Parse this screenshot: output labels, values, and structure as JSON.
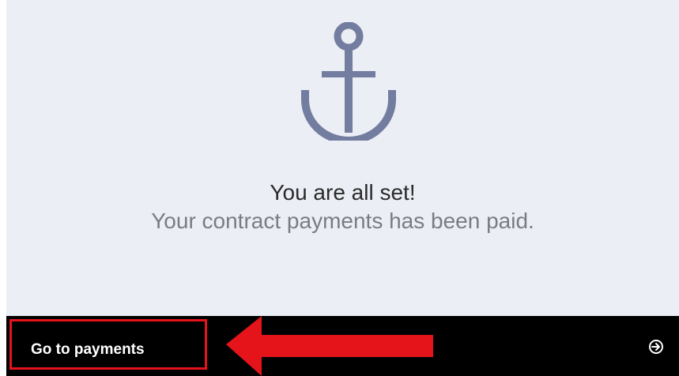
{
  "message": {
    "title": "You are all set!",
    "subtitle": "Your contract payments has been paid."
  },
  "footer": {
    "button_label": "Go to payments"
  },
  "icons": {
    "hero": "anchor-icon",
    "next": "arrow-circle-right-icon",
    "annotation": "red-arrow-icon"
  },
  "colors": {
    "panel_background": "#eceef5",
    "anchor": "#737d9f",
    "footer_background": "#000000",
    "highlight": "#e5141b",
    "title_text": "#2b2b2b",
    "subtitle_text": "#7a7c84"
  }
}
